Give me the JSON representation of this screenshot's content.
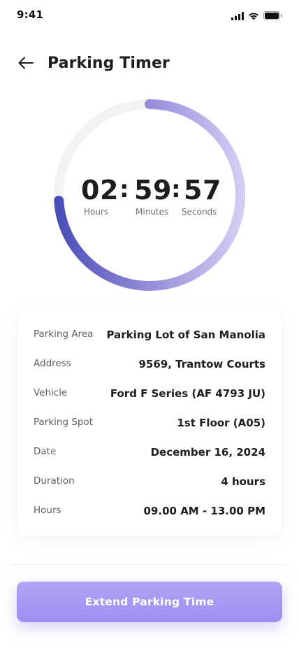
{
  "status_bar": {
    "time": "9:41"
  },
  "header": {
    "title": "Parking Timer",
    "back_icon": "arrow-left-icon"
  },
  "timer": {
    "hours": "02",
    "minutes": "59",
    "seconds": "57",
    "separator": ":",
    "hours_label": "Hours",
    "minutes_label": "Minutes",
    "seconds_label": "Seconds",
    "remaining_fraction": 0.74,
    "track_color": "#f3f3f5",
    "gradient_start": "#4a4eb9",
    "gradient_end": "#d3cdf3"
  },
  "details": [
    {
      "label": "Parking Area",
      "value": "Parking Lot of San Manolia"
    },
    {
      "label": "Address",
      "value": "9569, Trantow Courts"
    },
    {
      "label": "Vehicle",
      "value": "Ford F Series (AF 4793 JU)"
    },
    {
      "label": "Parking Spot",
      "value": "1st Floor (A05)"
    },
    {
      "label": "Date",
      "value": "December 16, 2024"
    },
    {
      "label": "Duration",
      "value": "4 hours"
    },
    {
      "label": "Hours",
      "value": "09.00 AM - 13.00 PM"
    }
  ],
  "actions": {
    "extend_label": "Extend Parking Time"
  },
  "colors": {
    "accent": "#9d8ff0",
    "text_primary": "#1e1e22",
    "text_secondary": "#5e5e66"
  }
}
